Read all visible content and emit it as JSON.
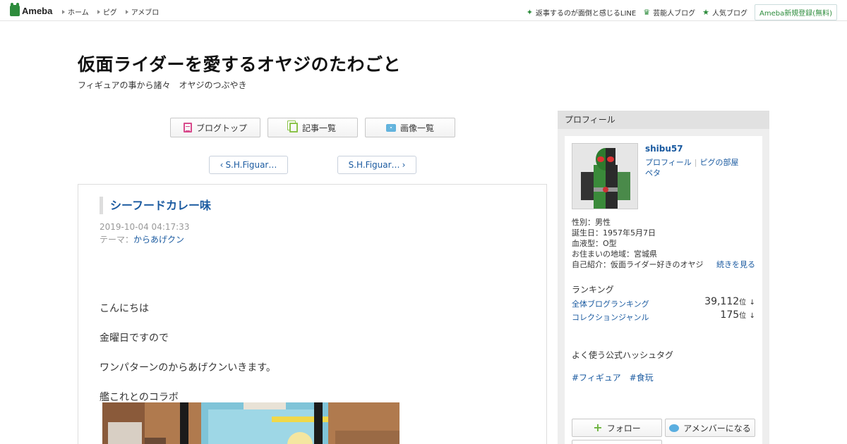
{
  "topbar": {
    "logo_text": "Ameba",
    "nav": [
      {
        "label": "ホーム"
      },
      {
        "label": "ピグ"
      },
      {
        "label": "アメブロ"
      }
    ],
    "right_links": [
      {
        "label": "返事するのが面倒と感じるLINE",
        "icon": "sparkle-icon"
      },
      {
        "label": "芸能人ブログ",
        "icon": "crown-icon"
      },
      {
        "label": "人気ブログ",
        "icon": "star-icon"
      }
    ],
    "register_label": "Ameba新規登録(無料)"
  },
  "header": {
    "title": "仮面ライダーを愛するオヤジのたわごと",
    "description": "フィギュアの事から諸々　オヤジのつぶやき"
  },
  "blog_nav": {
    "top_label": "ブログトップ",
    "list_label": "記事一覧",
    "images_label": "画像一覧"
  },
  "pager": {
    "prev_label": "S.H.Figuar…",
    "next_label": "S.H.Figuar…"
  },
  "entry": {
    "title": "シーフードカレー味",
    "date": "2019-10-04 04:17:33",
    "theme_prefix": "テーマ：",
    "theme": "からあげクン",
    "body": [
      "こんにちは",
      "金曜日ですので",
      "ワンパターンのからあげクンいきます。",
      "艦これとのコラボ"
    ]
  },
  "sidebar": {
    "header": "プロフィール",
    "username": "shibu57",
    "profile_link": "プロフィール",
    "pig_link": "ピグの部屋",
    "peta_link": "ペタ",
    "info": [
      "性別：男性",
      "誕生日：1957年5月7日",
      "血液型：O型",
      "お住まいの地域：宮城県",
      "自己紹介：仮面ライダー好きのオヤジ"
    ],
    "more_label": "続きを見る",
    "ranking_title": "ランキング",
    "rankings": [
      {
        "label": "全体ブログランキング",
        "value": "39,112",
        "unit": "位",
        "trend": "↓"
      },
      {
        "label": "コレクションジャンル",
        "value": "175",
        "unit": "位",
        "trend": "↓"
      }
    ],
    "hashtag_title": "よく使う公式ハッシュタグ",
    "hashtags": [
      "#フィギュア",
      "#食玩"
    ],
    "follow_label": "フォロー",
    "amember_label": "アメンバーになる"
  }
}
